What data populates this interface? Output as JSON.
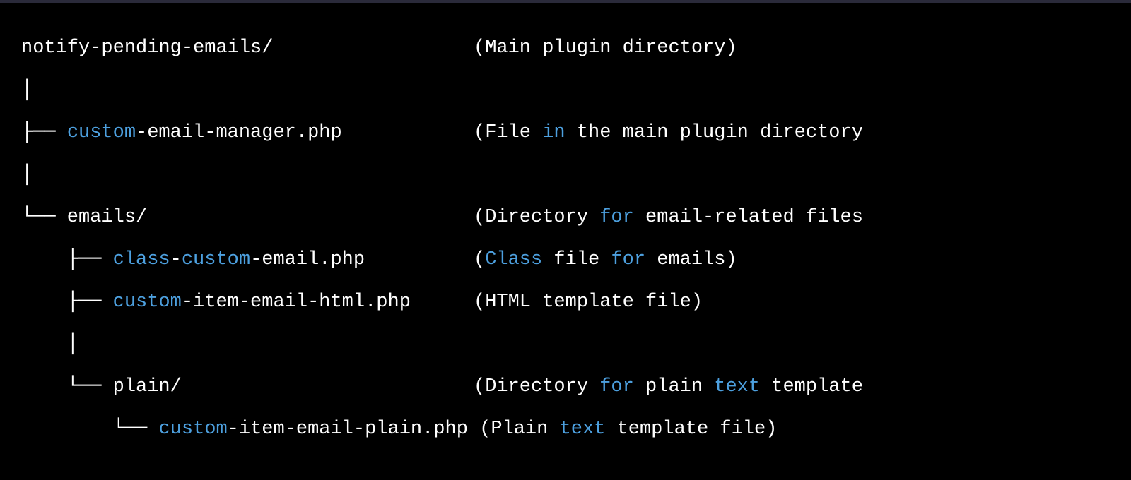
{
  "colors": {
    "background": "#000000",
    "text": "#ffffff",
    "highlight": "#4da0df"
  },
  "lines": [
    {
      "left": [
        {
          "t": "notify-pending-emails/",
          "c": "white"
        }
      ],
      "right": [
        {
          "t": "(Main plugin directory)",
          "c": "white"
        }
      ]
    },
    {
      "left": [
        {
          "t": "│",
          "c": "white"
        }
      ],
      "right": []
    },
    {
      "left": [
        {
          "t": "├── ",
          "c": "white"
        },
        {
          "t": "custom",
          "c": "blue"
        },
        {
          "t": "-email-manager.php",
          "c": "white"
        }
      ],
      "right": [
        {
          "t": "(File ",
          "c": "white"
        },
        {
          "t": "in",
          "c": "blue"
        },
        {
          "t": " the main plugin directory",
          "c": "white"
        }
      ]
    },
    {
      "left": [
        {
          "t": "│",
          "c": "white"
        }
      ],
      "right": []
    },
    {
      "left": [
        {
          "t": "└── emails/",
          "c": "white"
        }
      ],
      "right": [
        {
          "t": "(Directory ",
          "c": "white"
        },
        {
          "t": "for",
          "c": "blue"
        },
        {
          "t": " email-related files",
          "c": "white"
        }
      ]
    },
    {
      "left": [
        {
          "t": "    ├── ",
          "c": "white"
        },
        {
          "t": "class",
          "c": "blue"
        },
        {
          "t": "-",
          "c": "white"
        },
        {
          "t": "custom",
          "c": "blue"
        },
        {
          "t": "-email.php",
          "c": "white"
        }
      ],
      "right": [
        {
          "t": "(",
          "c": "white"
        },
        {
          "t": "Class",
          "c": "blue"
        },
        {
          "t": " file ",
          "c": "white"
        },
        {
          "t": "for",
          "c": "blue"
        },
        {
          "t": " emails)",
          "c": "white"
        }
      ]
    },
    {
      "left": [
        {
          "t": "    ├── ",
          "c": "white"
        },
        {
          "t": "custom",
          "c": "blue"
        },
        {
          "t": "-item-email-html.php",
          "c": "white"
        }
      ],
      "right": [
        {
          "t": "(HTML template file)",
          "c": "white"
        }
      ]
    },
    {
      "left": [
        {
          "t": "    │",
          "c": "white"
        }
      ],
      "right": []
    },
    {
      "left": [
        {
          "t": "    └── plain/",
          "c": "white"
        }
      ],
      "right": [
        {
          "t": "(Directory ",
          "c": "white"
        },
        {
          "t": "for",
          "c": "blue"
        },
        {
          "t": " plain ",
          "c": "white"
        },
        {
          "t": "text",
          "c": "blue"
        },
        {
          "t": " template",
          "c": "white"
        }
      ]
    },
    {
      "left": [
        {
          "t": "        └── ",
          "c": "white"
        },
        {
          "t": "custom",
          "c": "blue"
        },
        {
          "t": "-item-email-plain.php ",
          "c": "white"
        }
      ],
      "right_inline": [
        {
          "t": "(Plain ",
          "c": "white"
        },
        {
          "t": "text",
          "c": "blue"
        },
        {
          "t": " template file)",
          "c": "white"
        }
      ]
    }
  ]
}
